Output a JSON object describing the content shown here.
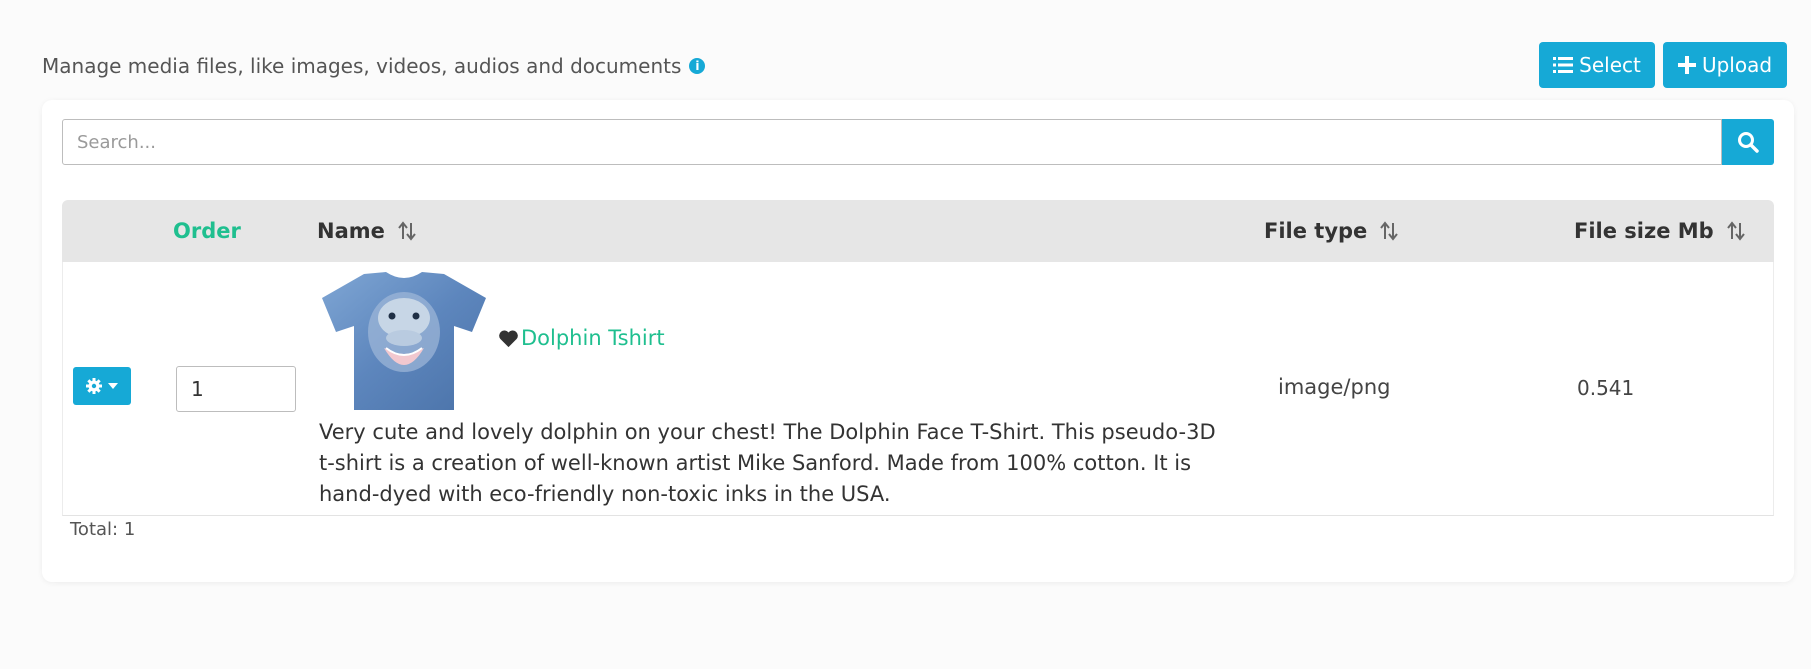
{
  "header": {
    "description": "Manage media files, like images, videos, audios and documents",
    "info_icon": "info-circle-icon"
  },
  "toolbar": {
    "select_label": "Select",
    "upload_label": "Upload",
    "accent_color": "#16a9d6"
  },
  "search": {
    "placeholder": "Search...",
    "value": ""
  },
  "table": {
    "columns": {
      "order": "Order",
      "name": "Name",
      "file_type": "File type",
      "file_size": "File size Mb"
    },
    "rows": [
      {
        "order": "1",
        "name": "Dolphin Tshirt",
        "description": "Very cute and lovely dolphin on your chest! The Dolphin Face T-Shirt. This pseudo-3D t-shirt is a creation of well-known artist Mike Sanford. Made from 100% cotton. It is hand-dyed with eco-friendly non-toxic inks in the USA.",
        "file_type": "image/png",
        "file_size": "0.541",
        "favorite_icon": "heart-icon",
        "actions_icon": "gear-icon"
      }
    ]
  },
  "footer": {
    "total": "Total: 1"
  }
}
